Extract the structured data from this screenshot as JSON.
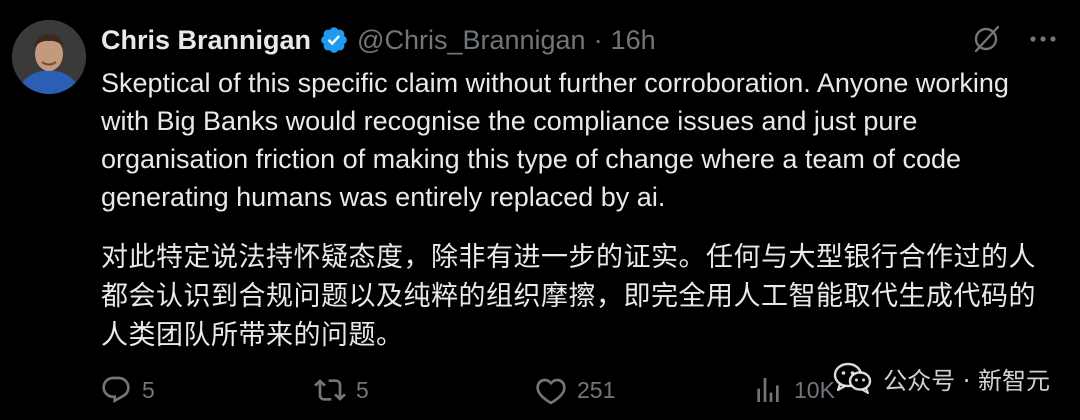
{
  "tweet": {
    "author": {
      "display_name": "Chris Brannigan",
      "handle": "@Chris_Brannigan",
      "verified": true,
      "avatar_icon": "avatar-photo"
    },
    "separator": "·",
    "time": "16h",
    "text_en": "Skeptical of this specific claim without further corroboration. Anyone working with Big Banks would recognise the compliance issues and just pure organisation friction of making this type of change where a team of code generating humans was entirely replaced by ai.",
    "text_zh": "对此特定说法持怀疑态度，除非有进一步的证实。任何与大型银行合作过的人都会认识到合规问题以及纯粹的组织摩擦，即完全用人工智能取代生成代码的人类团队所带来的问题。"
  },
  "top_actions": {
    "grok_icon": "slash-circle-icon",
    "more_icon": "more-dots-icon"
  },
  "actions": {
    "replies": "5",
    "reposts": "5",
    "likes": "251",
    "views": "10K"
  },
  "watermark": {
    "text": "公众号 · 新智元",
    "icon": "wechat-icon"
  },
  "colors": {
    "background": "#000000",
    "primary_text": "#e7e9ea",
    "secondary_text": "#71767b",
    "verified_blue": "#1d9bf0"
  }
}
